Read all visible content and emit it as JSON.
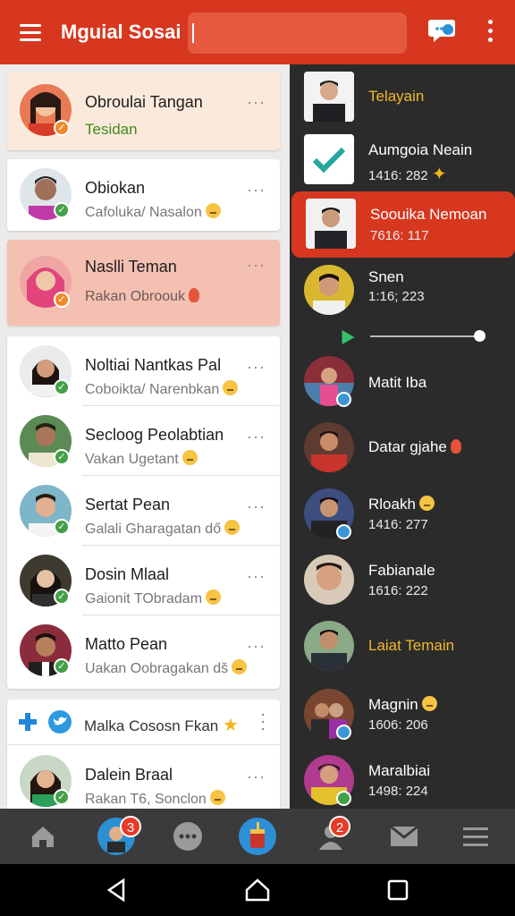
{
  "header": {
    "title": "Mguial Sosai",
    "search_value": "",
    "chat_icon": "chat-bubble-icon",
    "more_icon": "more-vert-icon",
    "color": "#d7371f"
  },
  "left_list": [
    {
      "name": "Obroulai Tangan",
      "sub": "Tesidan",
      "bg": "#fbeadb"
    },
    {
      "name": "Obiokan",
      "sub": "Cafoluka/ Nasalon"
    },
    {
      "name": "Naslli Teman",
      "sub": "Rakan Obroouk",
      "bg": "#f4c0b2"
    },
    {
      "name": "Noltiai Nantkas Pal",
      "sub": "Coboikta/ Narenbkan"
    },
    {
      "name": "Secloog Peolabtian",
      "sub": "Vakan Ugetant"
    },
    {
      "name": "Sertat Pean",
      "sub": "Galali Gharagatan dő"
    },
    {
      "name": "Dosin Mlaal",
      "sub": "Gaionit TObradam"
    },
    {
      "name": "Matto Pean",
      "sub": "Uakan Oobragakan dš"
    },
    {
      "name": "Malka Cososn Fkan"
    },
    {
      "name": "Dalein Braal",
      "sub": "Rakan T6, Sonclon"
    }
  ],
  "right_list": [
    {
      "name": "Telayain"
    },
    {
      "name": "Aumgoia Neain",
      "sub": "1416: 282"
    },
    {
      "name": "Soouika Nemoan",
      "sub": "7616: 117"
    },
    {
      "name": "Snen",
      "sub": "1:16; 223"
    },
    {
      "name": "Matit Iba"
    },
    {
      "name": "Datar gjahe"
    },
    {
      "name": "Rloakh",
      "sub": "1416: 277"
    },
    {
      "name": "Fabianale",
      "sub": "1616: 222"
    },
    {
      "name": "Laiat Temain"
    },
    {
      "name": "Magnin",
      "sub": "1606: 206"
    },
    {
      "name": "Maralbiai",
      "sub": "1498: 224"
    }
  ],
  "bottom_nav": {
    "badge_profile": "3",
    "badge_friends": "2"
  }
}
